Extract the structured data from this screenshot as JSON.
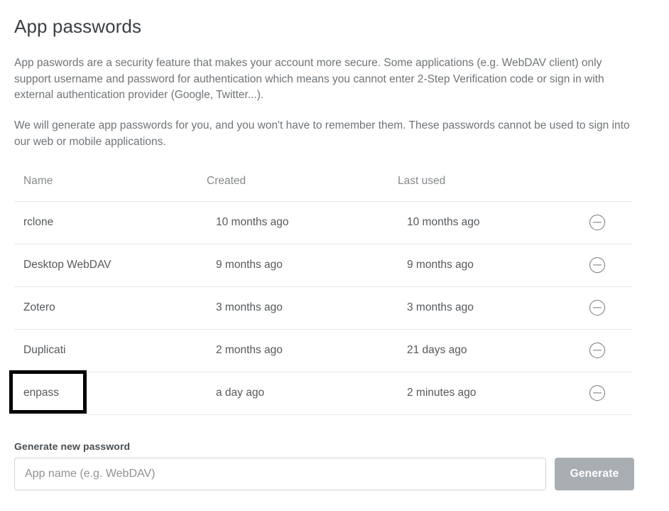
{
  "page": {
    "title": "App passwords",
    "intro_paragraph_1": "App paswords are a security feature that makes your account more secure. Some applications (e.g. WebDAV client) only support username and password for authentication which means you cannot enter 2-Step Verification code or sign in with external authentication provider (Google, Twitter...).",
    "intro_paragraph_2": "We will generate app passwords for you, and you won't have to remember them. These passwords cannot be used to sign into our web or mobile applications."
  },
  "table": {
    "columns": [
      "Name",
      "Created",
      "Last used"
    ],
    "rows": [
      {
        "name": "rclone",
        "created": "10 months ago",
        "last_used": "10 months ago",
        "remove_icon": "minus-circle-icon"
      },
      {
        "name": "Desktop WebDAV",
        "created": "9 months ago",
        "last_used": "9 months ago",
        "remove_icon": "minus-circle-icon"
      },
      {
        "name": "Zotero",
        "created": "3 months ago",
        "last_used": "3 months ago",
        "remove_icon": "minus-circle-icon"
      },
      {
        "name": "Duplicati",
        "created": "2 months ago",
        "last_used": "21 days ago",
        "remove_icon": "minus-circle-icon"
      },
      {
        "name": "enpass",
        "created": "a day ago",
        "last_used": "2 minutes ago",
        "remove_icon": "minus-circle-icon"
      }
    ],
    "highlighted_row_index": 4
  },
  "generate": {
    "label": "Generate new password",
    "input_value": "",
    "input_placeholder": "App name (e.g. WebDAV)",
    "button_label": "Generate"
  },
  "colors": {
    "heading": "#3b4044",
    "body_text": "#6f7478",
    "table_header": "#86898c",
    "table_cell": "#55595c",
    "row_divider": "#e9e9e9",
    "input_border": "#d4d4d4",
    "button_background": "#a8aeb2",
    "button_text": "#ffffff",
    "highlight_outline": "#000000",
    "icon": "#71767a",
    "background": "#ffffff"
  }
}
